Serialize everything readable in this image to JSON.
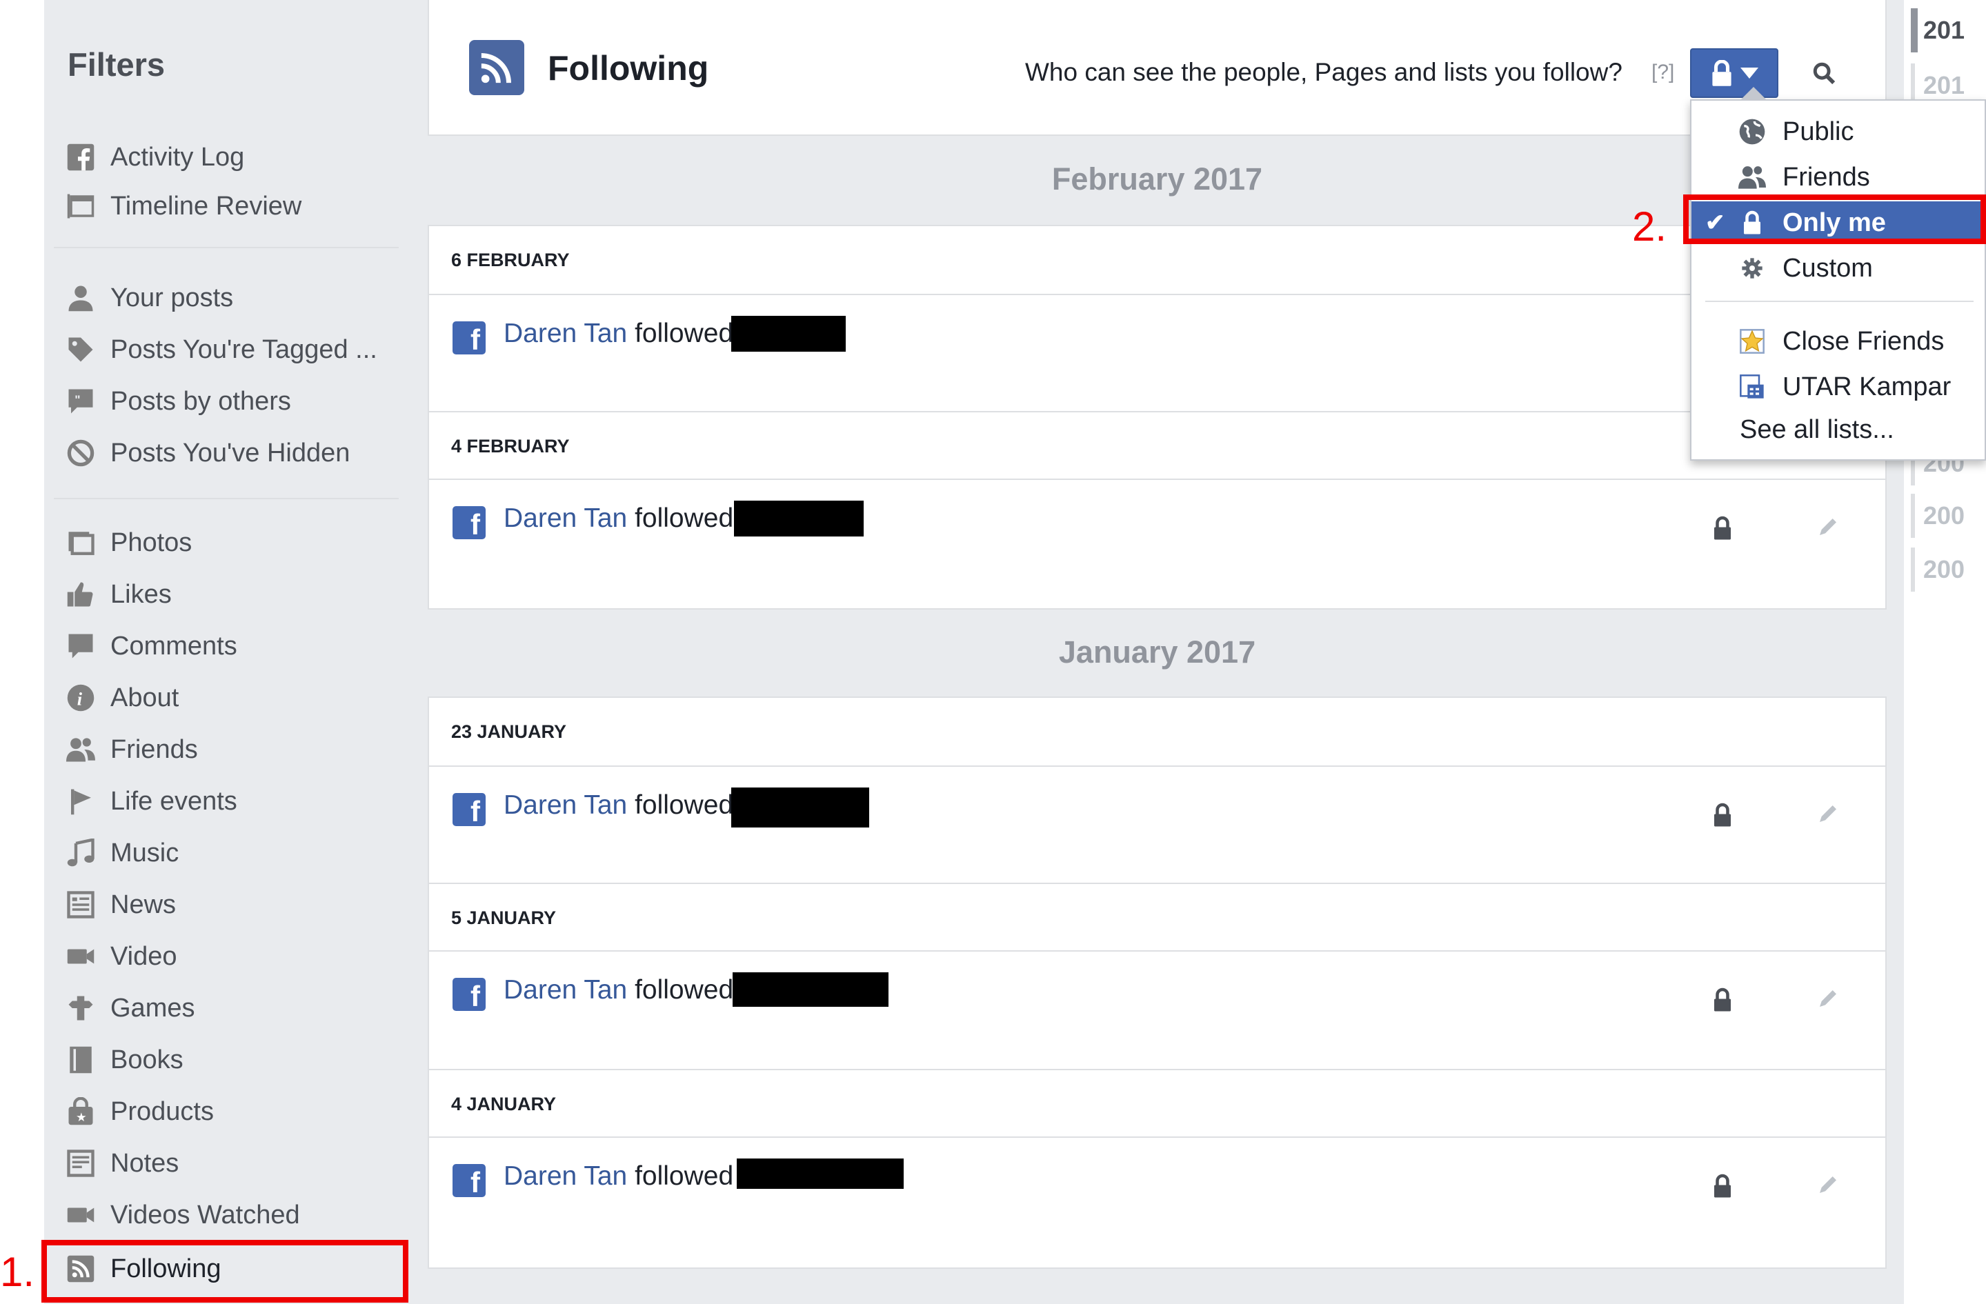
{
  "sidebar": {
    "title": "Filters",
    "items": [
      {
        "label": "Activity Log",
        "icon": "facebook-square-icon"
      },
      {
        "label": "Timeline Review",
        "icon": "timeline-review-icon"
      },
      {
        "label": "Your posts",
        "icon": "person-icon"
      },
      {
        "label": "Posts You're Tagged ...",
        "icon": "tag-icon"
      },
      {
        "label": "Posts by others",
        "icon": "speech-bubble-icon"
      },
      {
        "label": "Posts You've Hidden",
        "icon": "hidden-icon"
      },
      {
        "label": "Photos",
        "icon": "photos-icon"
      },
      {
        "label": "Likes",
        "icon": "thumbs-up-icon"
      },
      {
        "label": "Comments",
        "icon": "comment-icon"
      },
      {
        "label": "About",
        "icon": "info-icon"
      },
      {
        "label": "Friends",
        "icon": "friends-icon"
      },
      {
        "label": "Life events",
        "icon": "flag-icon"
      },
      {
        "label": "Music",
        "icon": "music-note-icon"
      },
      {
        "label": "News",
        "icon": "news-icon"
      },
      {
        "label": "Video",
        "icon": "video-camera-icon"
      },
      {
        "label": "Games",
        "icon": "game-piece-icon"
      },
      {
        "label": "Books",
        "icon": "book-icon"
      },
      {
        "label": "Products",
        "icon": "shopping-bag-icon"
      },
      {
        "label": "Notes",
        "icon": "notes-icon"
      },
      {
        "label": "Videos Watched",
        "icon": "video-camera-icon"
      },
      {
        "label": "Following",
        "icon": "rss-icon"
      }
    ]
  },
  "header": {
    "title": "Following",
    "question": "Who can see the people, Pages and lists you follow?",
    "help": "[?]",
    "privacy_selected": "Only me"
  },
  "sections": [
    {
      "month": "February 2017",
      "days": [
        {
          "date": "6 FEBRUARY",
          "entries": [
            {
              "name": "Daren Tan",
              "action": "followed"
            }
          ]
        },
        {
          "date": "4 FEBRUARY",
          "entries": [
            {
              "name": "Daren Tan",
              "action": "followed"
            }
          ]
        }
      ]
    },
    {
      "month": "January 2017",
      "days": [
        {
          "date": "23 JANUARY",
          "entries": [
            {
              "name": "Daren Tan",
              "action": "followed"
            }
          ]
        },
        {
          "date": "5 JANUARY",
          "entries": [
            {
              "name": "Daren Tan",
              "action": "followed"
            }
          ]
        },
        {
          "date": "4 JANUARY",
          "entries": [
            {
              "name": "Daren Tan",
              "action": "followed"
            }
          ]
        }
      ]
    }
  ],
  "year_nav": [
    "201",
    "201",
    "200",
    "200",
    "200",
    "200"
  ],
  "privacy_dropdown": {
    "options": [
      {
        "label": "Public",
        "icon": "globe-icon"
      },
      {
        "label": "Friends",
        "icon": "friends-icon"
      },
      {
        "label": "Only me",
        "icon": "lock-icon",
        "selected": true
      },
      {
        "label": "Custom",
        "icon": "gear-icon"
      }
    ],
    "lists": [
      {
        "label": "Close Friends",
        "icon": "star-icon"
      },
      {
        "label": "UTAR Kampar",
        "icon": "building-icon"
      }
    ],
    "see_all": "See all lists..."
  },
  "annotations": {
    "step1": "1.",
    "step2": "2."
  },
  "colors": {
    "brand": "#4267b2",
    "link": "#365899",
    "annotation": "#ee0000",
    "background": "#e9ebee"
  }
}
